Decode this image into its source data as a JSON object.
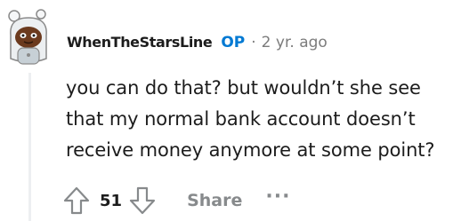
{
  "comment": {
    "author": "WhenTheStarsLine",
    "op_badge": "OP",
    "separator": "·",
    "age": "2 yr. ago",
    "lines": [
      "you can do that? but wouldn’t she see",
      "that my normal bank account doesn’t",
      "receive money anymore at some point?"
    ]
  },
  "actions": {
    "score": "51",
    "share_label": "Share",
    "more_label": "···"
  },
  "icons": {
    "avatar": "snoo-avatar",
    "upvote": "upvote-arrow-icon",
    "downvote": "downvote-arrow-icon",
    "more": "more-options-icon"
  },
  "colors": {
    "op": "#0079d3",
    "meta_gray": "#7c7c7c",
    "action_gray": "#878a8c",
    "text": "#1c1c1c"
  }
}
